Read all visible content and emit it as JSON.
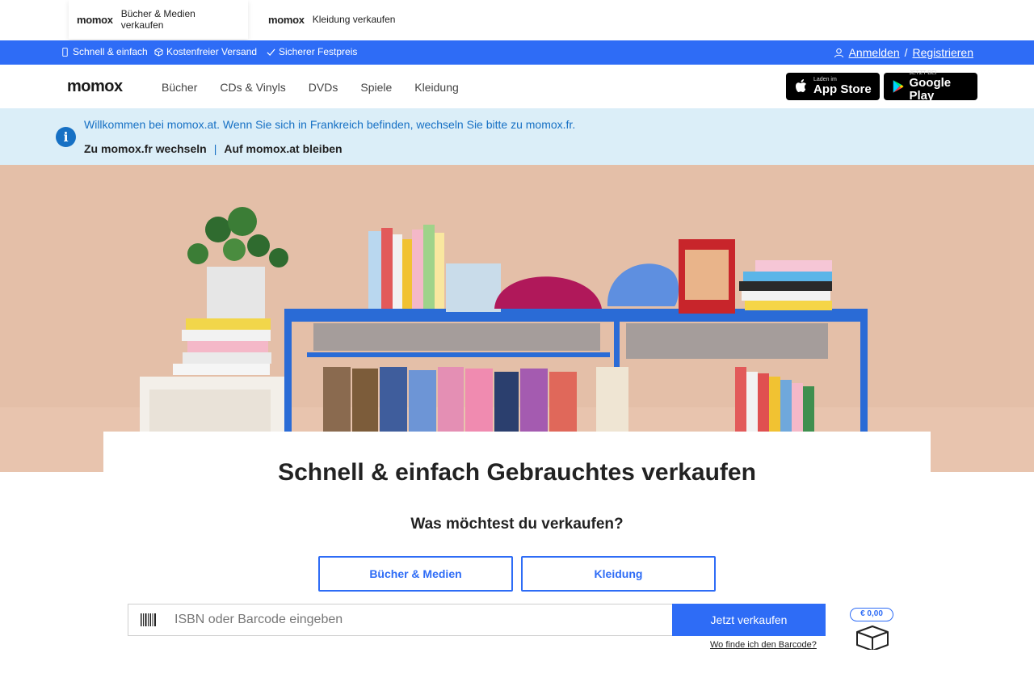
{
  "brand_tabs": {
    "books": {
      "logo": "momox",
      "label": "Bücher & Medien verkaufen"
    },
    "clothes": {
      "logo": "momox",
      "label": "Kleidung verkaufen"
    }
  },
  "usp": {
    "item1": "Schnell & einfach",
    "item2": "Kostenfreier Versand",
    "item3": "Sicherer Festpreis"
  },
  "account": {
    "login": "Anmelden",
    "separator": "/",
    "register": "Registrieren"
  },
  "nav": {
    "logo": "momox",
    "links": [
      "Bücher",
      "CDs & Vinyls",
      "DVDs",
      "Spiele",
      "Kleidung"
    ]
  },
  "stores": {
    "apple": {
      "small": "Laden im",
      "big": "App Store"
    },
    "google": {
      "small": "JETZT BEI",
      "big": "Google Play"
    }
  },
  "locale_banner": {
    "message": "Willkommen bei momox.at. Wenn Sie sich in Frankreich befinden, wechseln Sie bitte zu momox.fr.",
    "switch": "Zu momox.fr wechseln",
    "separator": "|",
    "stay": "Auf momox.at bleiben"
  },
  "sell": {
    "title": "Schnell & einfach Gebrauchtes verkaufen",
    "question": "Was möchtest du verkaufen?",
    "category_books": "Bücher & Medien",
    "category_clothes": "Kleidung",
    "search_placeholder": "ISBN oder Barcode eingeben",
    "button": "Jetzt verkaufen",
    "barcode_help": "Wo finde ich den Barcode?",
    "box_price": "€ 0,00"
  },
  "colors": {
    "primary": "#2e6cf6",
    "info": "#1670c4",
    "banner_bg": "#dbeef8",
    "hero_bg": "#e4bfa8"
  }
}
